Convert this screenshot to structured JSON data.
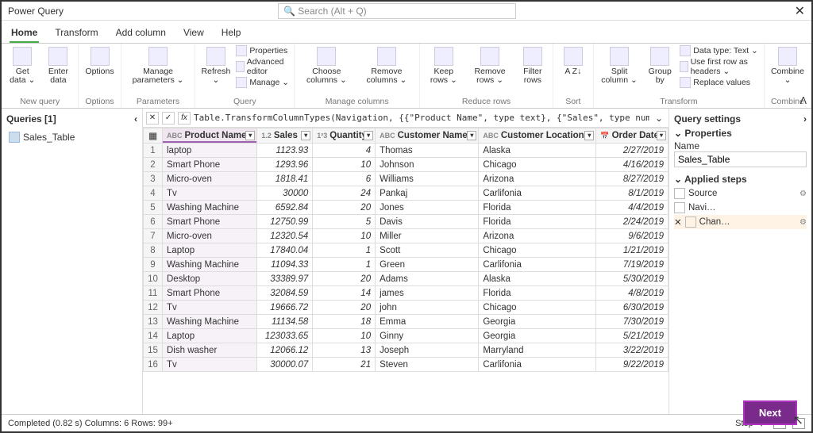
{
  "window": {
    "title": "Power Query",
    "search_placeholder": "Search (Alt + Q)",
    "close": "✕"
  },
  "tabs": {
    "home": "Home",
    "transform": "Transform",
    "addcolumn": "Add column",
    "view": "View",
    "help": "Help"
  },
  "ribbon": {
    "new_query": {
      "get_data": "Get\ndata ⌄",
      "enter_data": "Enter\ndata",
      "label": "New query"
    },
    "options": {
      "options": "Options",
      "label": "Options"
    },
    "parameters": {
      "manage": "Manage\nparameters ⌄",
      "label": "Parameters"
    },
    "query": {
      "refresh": "Refresh\n⌄",
      "properties": "Properties",
      "advanced": "Advanced editor",
      "manage": "Manage ⌄",
      "label": "Query"
    },
    "manage_columns": {
      "choose": "Choose\ncolumns ⌄",
      "remove": "Remove\ncolumns ⌄",
      "label": "Manage columns"
    },
    "reduce_rows": {
      "keep": "Keep\nrows ⌄",
      "remove": "Remove\nrows ⌄",
      "filter": "Filter\nrows",
      "label": "Reduce rows"
    },
    "sort": {
      "sort": "A\nZ↓",
      "label": "Sort"
    },
    "transform": {
      "split": "Split\ncolumn ⌄",
      "group": "Group\nby",
      "datatype": "Data type: Text ⌄",
      "firstrow": "Use first row as headers ⌄",
      "replace": "Replace values",
      "label": "Transform"
    },
    "combine": {
      "combine": "Combine\n⌄",
      "label": "Combine"
    }
  },
  "queries": {
    "title": "Queries [1]",
    "collapse": "‹",
    "items": [
      {
        "name": "Sales_Table"
      }
    ]
  },
  "formula": "Table.TransformColumnTypes(Navigation, {{\"Product Name\", type text}, {\"Sales\", type number},",
  "columns": [
    {
      "name": "Product Name",
      "type": "ABC",
      "selected": true
    },
    {
      "name": "Sales",
      "type": "1.2"
    },
    {
      "name": "Quantity",
      "type": "1²3"
    },
    {
      "name": "Customer Name",
      "type": "ABC"
    },
    {
      "name": "Customer Location",
      "type": "ABC"
    },
    {
      "name": "Order Date",
      "type": "📅"
    }
  ],
  "rows": [
    [
      "laptop",
      "1123.93",
      "4",
      "Thomas",
      "Alaska",
      "2/27/2019"
    ],
    [
      "Smart Phone",
      "1293.96",
      "10",
      "Johnson",
      "Chicago",
      "4/16/2019"
    ],
    [
      "Micro-oven",
      "1818.41",
      "6",
      "Williams",
      "Arizona",
      "8/27/2019"
    ],
    [
      "Tv",
      "30000",
      "24",
      "Pankaj",
      "Carlifonia",
      "8/1/2019"
    ],
    [
      "Washing Machine",
      "6592.84",
      "20",
      "Jones",
      "Florida",
      "4/4/2019"
    ],
    [
      "Smart Phone",
      "12750.99",
      "5",
      "Davis",
      "Florida",
      "2/24/2019"
    ],
    [
      "Micro-oven",
      "12320.54",
      "10",
      "Miller",
      "Arizona",
      "9/6/2019"
    ],
    [
      "Laptop",
      "17840.04",
      "1",
      "Scott",
      "Chicago",
      "1/21/2019"
    ],
    [
      "Washing Machine",
      "11094.33",
      "1",
      "Green",
      "Carlifonia",
      "7/19/2019"
    ],
    [
      "Desktop",
      "33389.97",
      "20",
      "Adams",
      "Alaska",
      "5/30/2019"
    ],
    [
      "Smart Phone",
      "32084.59",
      "14",
      "james",
      "Florida",
      "4/8/2019"
    ],
    [
      "Tv",
      "19666.72",
      "20",
      "john",
      "Chicago",
      "6/30/2019"
    ],
    [
      "Washing Machine",
      "11134.58",
      "18",
      "Emma",
      "Georgia",
      "7/30/2019"
    ],
    [
      "Laptop",
      "123033.65",
      "10",
      "Ginny",
      "Georgia",
      "5/21/2019"
    ],
    [
      "Dish washer",
      "12066.12",
      "13",
      "Joseph",
      "Marryland",
      "3/22/2019"
    ],
    [
      "Tv",
      "30000.07",
      "21",
      "Steven",
      "Carlifonia",
      "9/22/2019"
    ]
  ],
  "settings": {
    "title": "Query settings",
    "expand": "›",
    "properties_label": "⌄ Properties",
    "name_label": "Name",
    "name_value": "Sales_Table",
    "applied_label": "⌄ Applied steps",
    "steps": [
      {
        "label": "Source",
        "gear": true
      },
      {
        "label": "Navi…"
      },
      {
        "label": "Chan…",
        "gear": true,
        "selected": true
      }
    ]
  },
  "status": {
    "text": "Completed (0.82 s)    Columns: 6    Rows: 99+",
    "step": "Step"
  },
  "next_button": "Next"
}
